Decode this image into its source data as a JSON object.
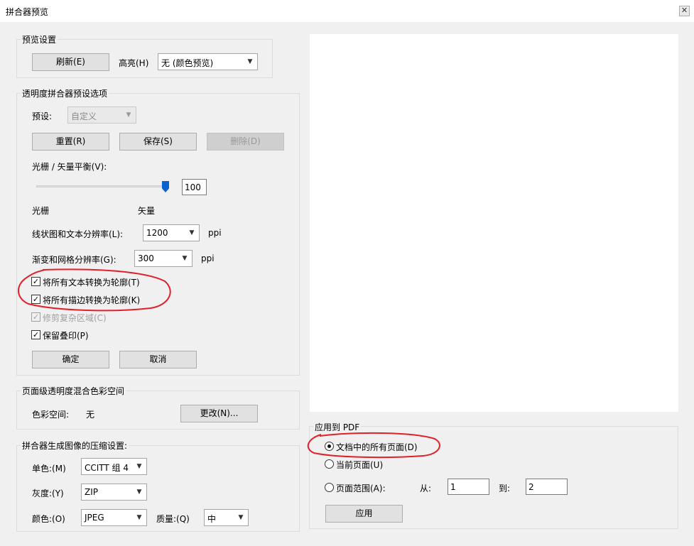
{
  "window": {
    "title": "拼合器预览",
    "close_glyph": "✕"
  },
  "preview_settings": {
    "legend": "预览设置",
    "refresh_button": "刷新(E)",
    "highlight_label": "高亮(H)",
    "highlight_value": "无 (颜色预览)"
  },
  "flattener_preset": {
    "legend": "透明度拼合器预设选项",
    "preset_label": "预设:",
    "preset_value": "自定义",
    "reset_button": "重置(R)",
    "save_button": "保存(S)",
    "delete_button": "删除(D)",
    "balance_label": "光栅 / 矢量平衡(V):",
    "balance_value": "100",
    "balance_level": 100,
    "raster_label": "光栅",
    "vector_label": "矢量",
    "line_res_label": "线状图和文本分辨率(L):",
    "line_res_value": "1200",
    "line_res_unit": "ppi",
    "gradient_res_label": "渐变和网格分辨率(G):",
    "gradient_res_value": "300",
    "gradient_res_unit": "ppi",
    "convert_text_label": "将所有文本转换为轮廓(T)",
    "convert_text_checked": true,
    "convert_strokes_label": "将所有描边转换为轮廓(K)",
    "convert_strokes_checked": true,
    "clip_complex_label": "修剪复杂区域(C)",
    "clip_complex_checked": true,
    "preserve_overprint_label": "保留叠印(P)",
    "preserve_overprint_checked": true,
    "ok_button": "确定",
    "cancel_button": "取消"
  },
  "blend_space": {
    "legend": "页面级透明度混合色彩空间",
    "colorspace_label": "色彩空间:",
    "colorspace_value": "无",
    "change_button": "更改(N)..."
  },
  "compression": {
    "legend": "拼合器生成图像的压缩设置:",
    "mono_label": "单色:(M)",
    "mono_value": "CCITT 组 4",
    "gray_label": "灰度:(Y)",
    "gray_value": "ZIP",
    "color_label": "颜色:(O)",
    "color_value": "JPEG",
    "quality_label": "质量:(Q)",
    "quality_value": "中"
  },
  "apply_pdf": {
    "legend": "应用到 PDF",
    "all_pages_label": "文档中的所有页面(D)",
    "current_page_label": "当前页面(U)",
    "page_range_label": "页面范围(A):",
    "from_label": "从:",
    "from_value": "1",
    "to_label": "到:",
    "to_value": "2",
    "selected": "all_pages",
    "apply_button": "应用"
  },
  "annotations": {
    "circle_color": "#e0202a"
  }
}
